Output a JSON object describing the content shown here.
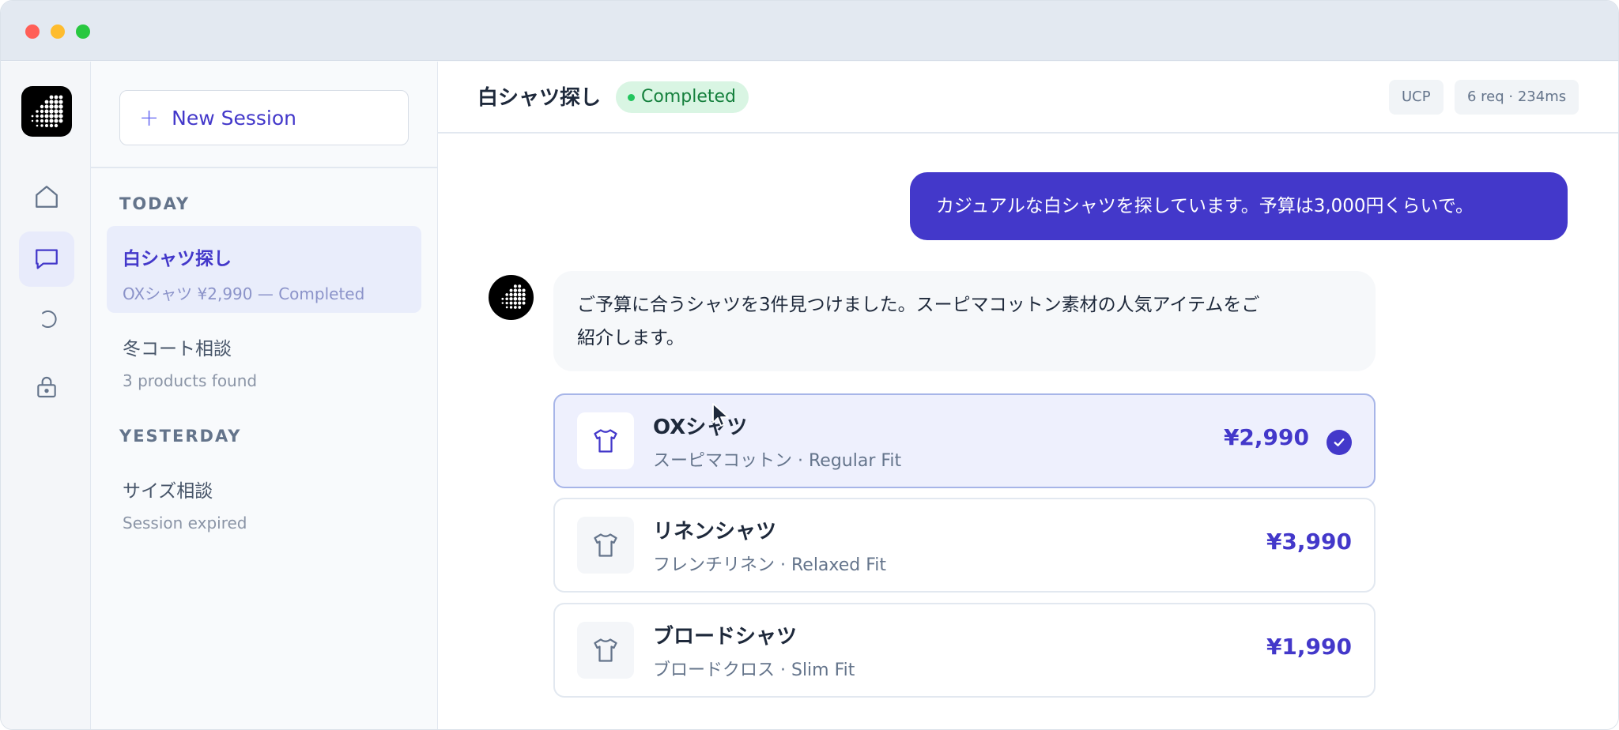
{
  "window": {
    "controls": [
      "close",
      "minimize",
      "zoom"
    ]
  },
  "rail": {
    "logo": "dotted-logo",
    "items": [
      {
        "icon": "home-icon",
        "active": false
      },
      {
        "icon": "chat-icon",
        "active": true
      },
      {
        "icon": "refresh-icon",
        "active": false
      },
      {
        "icon": "lock-icon",
        "active": false
      }
    ]
  },
  "sessions": {
    "new_session_icon": "+",
    "new_session_label": "New Session",
    "today_label": "TODAY",
    "yesterday_label": "YESTERDAY",
    "today": [
      {
        "title": "白シャツ探し",
        "subtitle": "OXシャツ ¥2,990 — Completed",
        "active": true
      },
      {
        "title": "冬コート相談",
        "subtitle": "3 products found",
        "active": false
      }
    ],
    "yesterday": [
      {
        "title": "サイズ相談",
        "subtitle": "Session expired",
        "active": false
      }
    ]
  },
  "header": {
    "title": "白シャツ探し",
    "status": "Completed",
    "chips": [
      "UCP",
      "6 req · 234ms"
    ]
  },
  "chat": {
    "user_message": "カジュアルな白シャツを探しています。予算は3,000円くらいで。",
    "bot_message_line1": "ご予算に合うシャツを3件見つけました。スーピマコットン素材の人気アイテムをご",
    "bot_message_line2": "紹介します。"
  },
  "products": [
    {
      "name": "OXシャツ",
      "description": "スーピマコットン · Regular Fit",
      "price": "¥2,990",
      "selected": true,
      "icon": "tshirt-icon"
    },
    {
      "name": "リネンシャツ",
      "description": "フレンチリネン · Relaxed Fit",
      "price": "¥3,990",
      "selected": false,
      "icon": "tshirt-icon"
    },
    {
      "name": "ブロードシャツ",
      "description": "ブロードクロス · Slim Fit",
      "price": "¥1,990",
      "selected": false,
      "icon": "tshirt-icon"
    }
  ],
  "colors": {
    "accent": "#4338ca",
    "success": "#15803d",
    "success_bg": "#d9f5e3",
    "selected_bg": "#eef0fd"
  }
}
